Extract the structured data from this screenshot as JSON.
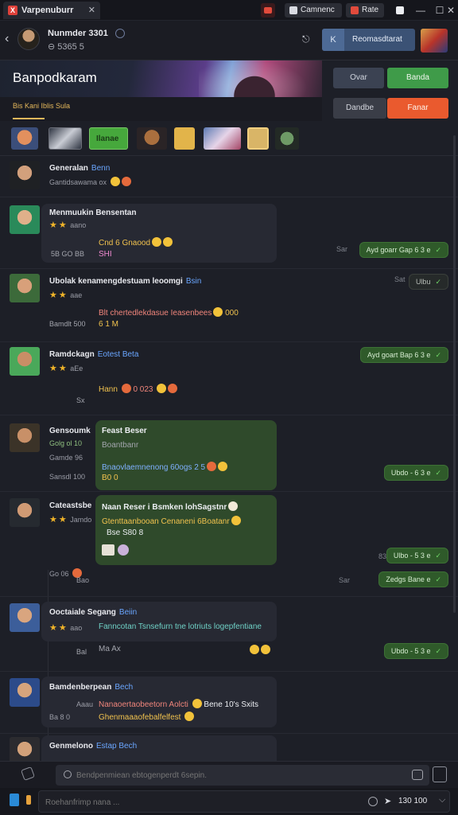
{
  "window": {
    "tab_title": "Varpenuburr",
    "tab_logo": "X",
    "close_glyph": "✕",
    "btn_camera": "Camnenc",
    "btn_side": "Rate",
    "minimize": "—",
    "maximize": "☐",
    "close": "✕"
  },
  "header": {
    "back_glyph": "‹",
    "name": "Nunmder 3301",
    "sub": "⊖ 5365 5",
    "link_glyph": "⎋",
    "user_key": "K",
    "user_label": "Reomasdtarat"
  },
  "banner": {
    "title": "Banpodkaram",
    "sub_tab": "Bis Kani Iblis Sula"
  },
  "side_buttons": {
    "b1": "Ovar",
    "b2": "Banda",
    "b3": "Dandbe",
    "b4": "Fanar"
  },
  "strip": {
    "chip3_label": "Ilanae"
  },
  "messages": [
    {
      "name": "Generalan",
      "tag": "Benn",
      "meta": "Gantidsawama ox"
    },
    {
      "name": "Menmuukin Bensentan",
      "tag": "",
      "stars": "★★",
      "meta": "aano",
      "line1": "Cnd 6 Gnaood",
      "line2_time": "5B GO BB",
      "line2": "SHI",
      "pill": "Ayd goarr Gap 6 3 e",
      "pill_time": "Sar"
    },
    {
      "name": "Ubolak kenamengdestuam leoomgi",
      "tag": "Bsin",
      "stars": "★★",
      "meta": "aae",
      "line1": "Blt chertedlekdasue Ieasenbees",
      "line1_end": "000",
      "line2_time": "Bamdlt 500",
      "line2": "6  1 M",
      "pill": "Ulbu",
      "pill_time": "Sat"
    },
    {
      "name": "Ramdckagn",
      "tag": "Eotest  Beta",
      "stars": "★★",
      "meta": "aEe",
      "line1": "Hann",
      "line1_mid": "0 023",
      "line2_time": "Sx",
      "pill": "Ayd goart Bap 6 3 e",
      "pill_time": ""
    },
    {
      "name": "Gensoumk",
      "tag": "",
      "meta": "Golg ol 10",
      "meta2": "Gamde 96",
      "meta3": "Sansdl 100",
      "bubble_title": "Feast Beser",
      "bubble_sub": "Boantbanr",
      "bubble_line": "Bnaovlaemnenong  60ogs 2 5",
      "bubble_line2": "B0 0",
      "pill": "Ubdo - 6 3 e",
      "pill_time": "8"
    },
    {
      "name": "Cateastsbe",
      "tag": "",
      "stars": "★★",
      "meta": "Jamdo",
      "bubble_title": "Naan Reser i Bsmken lohSagstnr",
      "bubble_line": "Gtenttaanbooan Cenaneni 6Boatanr",
      "bubble_line2": "Bse S80 8",
      "meta2": "Go 06",
      "meta3": "Bao",
      "pill": "Ulbo - 5 3 e",
      "pill_time": "83",
      "pill2": "Zedgs   Bane e",
      "pill2_time": "Sar"
    },
    {
      "name": "Ooctaiale Segang",
      "tag": "Beiin",
      "stars": "★★",
      "meta": "aao",
      "line1": "Fanncotan Tsnsefurn tne lotriuts logepfentiane",
      "line2_time": "Bal",
      "line2": "Ma Ax",
      "pill": "Ubdo - 5 3 e",
      "pill_time": ""
    },
    {
      "name": "Bamdenberpean",
      "tag": "Bech",
      "meta": "Aaau",
      "meta2": "Ba 8 0",
      "line1": "Nanaoertaobeetorn Aolcti",
      "line1_end": "Bene 10's Sxits",
      "line2": "Ghenmaaaofebalfelfest"
    },
    {
      "name": "Genmelono",
      "tag": "Estap  Bech",
      "meta": ""
    }
  ],
  "composer": {
    "placeholder": "Bendpenmiean ebtogenperdt 6sepin."
  },
  "footer": {
    "placeholder": "Roehanfrimp nana ...",
    "send_glyph": "➤",
    "count": "130  100",
    "chev": "⌵"
  }
}
